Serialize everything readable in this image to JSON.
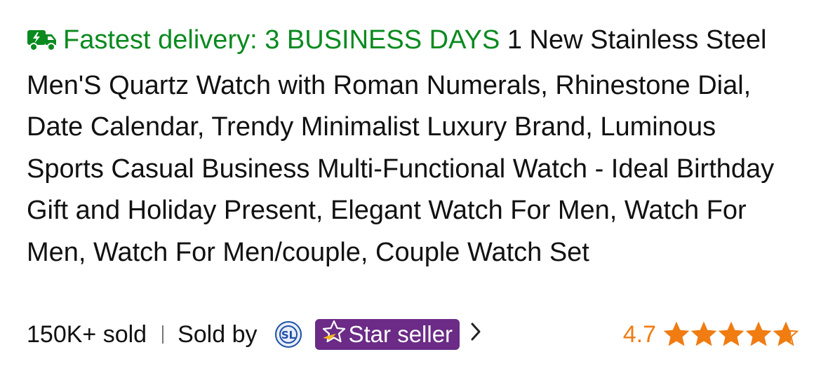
{
  "delivery": {
    "icon": "delivery-truck-icon",
    "label": "Fastest delivery: 3 BUSINESS DAYS"
  },
  "product": {
    "title": "1 New Stainless Steel Men'S Quartz Watch with Roman Numerals, Rhinestone Dial, Date Calendar, Trendy Minimalist Luxury Brand, Luminous Sports Casual Business Multi-Functional Watch - Ideal Birthday Gift and Holiday Present, Elegant Watch For Men, Watch For Men, Watch For Men/couple, Couple Watch Set"
  },
  "sales": {
    "sold": "150K+ sold",
    "sold_by": "Sold by"
  },
  "seller": {
    "logo": "seller-logo-icon",
    "badge_label": "Star seller",
    "badge_color": "#6b2b86"
  },
  "rating": {
    "value": "4.7",
    "stars": 4.7,
    "color": "#f07c12"
  },
  "colors": {
    "delivery_green": "#0a8a1f",
    "text": "#111111"
  }
}
